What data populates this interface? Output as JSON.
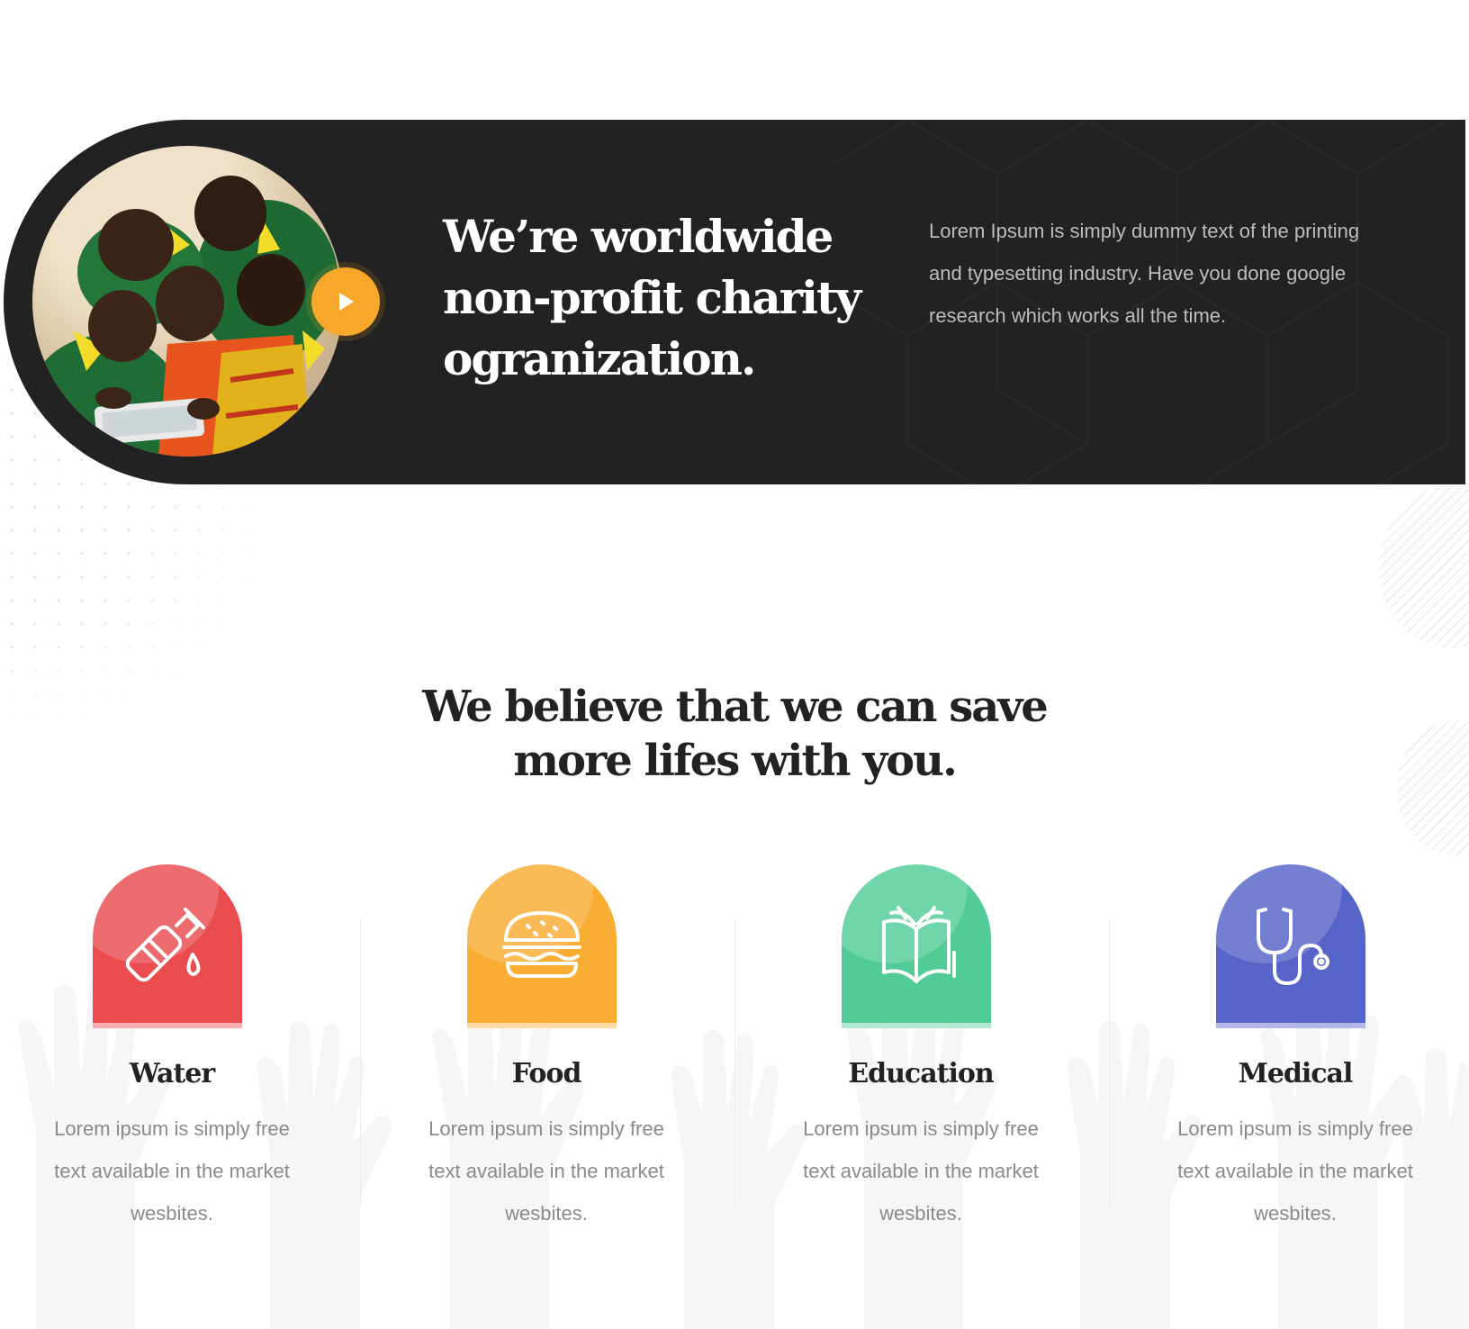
{
  "banner": {
    "title_line1": "We’re worldwide",
    "title_line2": "non-profit charity",
    "title_line3": "ogranization.",
    "description": "Lorem Ipsum is simply dummy text of the printing and typesetting industry. Have you done google research which works all the time.",
    "play_icon": "play-icon",
    "accent_color": "#f7a82a",
    "background_color": "#222222"
  },
  "section": {
    "title_line1": "We believe that we can save",
    "title_line2": "more lifes with you."
  },
  "cards": [
    {
      "title": "Water",
      "text": "Lorem ipsum is simply free text available in the market wesbites.",
      "icon": "water-bottle-icon",
      "color": "#ea4b4f"
    },
    {
      "title": "Food",
      "text": "Lorem ipsum is simply free text available in the market wesbites.",
      "icon": "burger-icon",
      "color": "#f9ad33"
    },
    {
      "title": "Education",
      "text": "Lorem ipsum is simply free text available in the market wesbites.",
      "icon": "book-icon",
      "color": "#51cc98"
    },
    {
      "title": "Medical",
      "text": "Lorem ipsum is simply free text available in the market wesbites.",
      "icon": "stethoscope-icon",
      "color": "#5663c8"
    }
  ]
}
